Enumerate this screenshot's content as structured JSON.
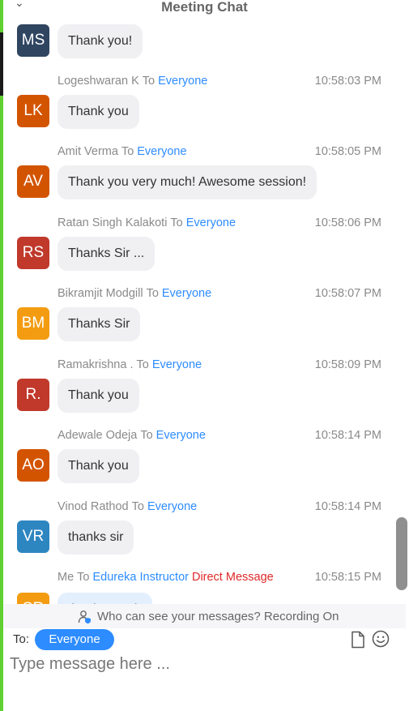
{
  "header": {
    "title": "Meeting Chat",
    "collapse_icon": "chevron-down-icon"
  },
  "messages": [
    {
      "sender": "",
      "to_word": "",
      "recipient": "",
      "time": "",
      "initials": "MS",
      "avatar_color": "#2f4560",
      "text": "Thank you!"
    },
    {
      "sender": "Logeshwaran K",
      "to_word": "To",
      "recipient": "Everyone",
      "time": "10:58:03 PM",
      "initials": "LK",
      "avatar_color": "#d35400",
      "text": "Thank you"
    },
    {
      "sender": "Amit Verma",
      "to_word": "To",
      "recipient": "Everyone",
      "time": "10:58:05 PM",
      "initials": "AV",
      "avatar_color": "#d35400",
      "text": "Thank you very much! Awesome session!"
    },
    {
      "sender": "Ratan Singh Kalakoti",
      "to_word": "To",
      "recipient": "Everyone",
      "time": "10:58:06 PM",
      "initials": "RS",
      "avatar_color": "#c0392b",
      "text": "Thanks Sir ..."
    },
    {
      "sender": "Bikramjit Modgill",
      "to_word": "To",
      "recipient": "Everyone",
      "time": "10:58:07 PM",
      "initials": "BM",
      "avatar_color": "#f39c12",
      "text": "Thanks Sir"
    },
    {
      "sender": "Ramakrishna .",
      "to_word": "To",
      "recipient": "Everyone",
      "time": "10:58:09 PM",
      "initials": "R.",
      "avatar_color": "#c0392b",
      "text": "Thank you"
    },
    {
      "sender": "Adewale Odeja",
      "to_word": "To",
      "recipient": "Everyone",
      "time": "10:58:14 PM",
      "initials": "AO",
      "avatar_color": "#d35400",
      "text": "Thank you"
    },
    {
      "sender": "Vinod Rathod",
      "to_word": "To",
      "recipient": "Everyone",
      "time": "10:58:14 PM",
      "initials": "VR",
      "avatar_color": "#2e86c1",
      "text": "thanks sir"
    },
    {
      "sender": "Me",
      "to_word": "To",
      "recipient": "Edureka Instructor",
      "dm_label": "Direct Message",
      "time": "10:58:15 PM",
      "initials": "SR",
      "avatar_color": "#f39c12",
      "text": "thank you sir"
    }
  ],
  "notice": {
    "text": "Who can see your messages? Recording On",
    "icon": "people-lock-icon"
  },
  "composer": {
    "to_label": "To:",
    "to_value": "Everyone",
    "placeholder": "Type message here ...",
    "file_icon": "file-icon",
    "emoji_icon": "emoji-icon"
  },
  "colors": {
    "accent": "#2d8cff",
    "direct_message": "#e02828",
    "bubble": "#f0f0f3",
    "left_strip": "#5fd02f"
  }
}
